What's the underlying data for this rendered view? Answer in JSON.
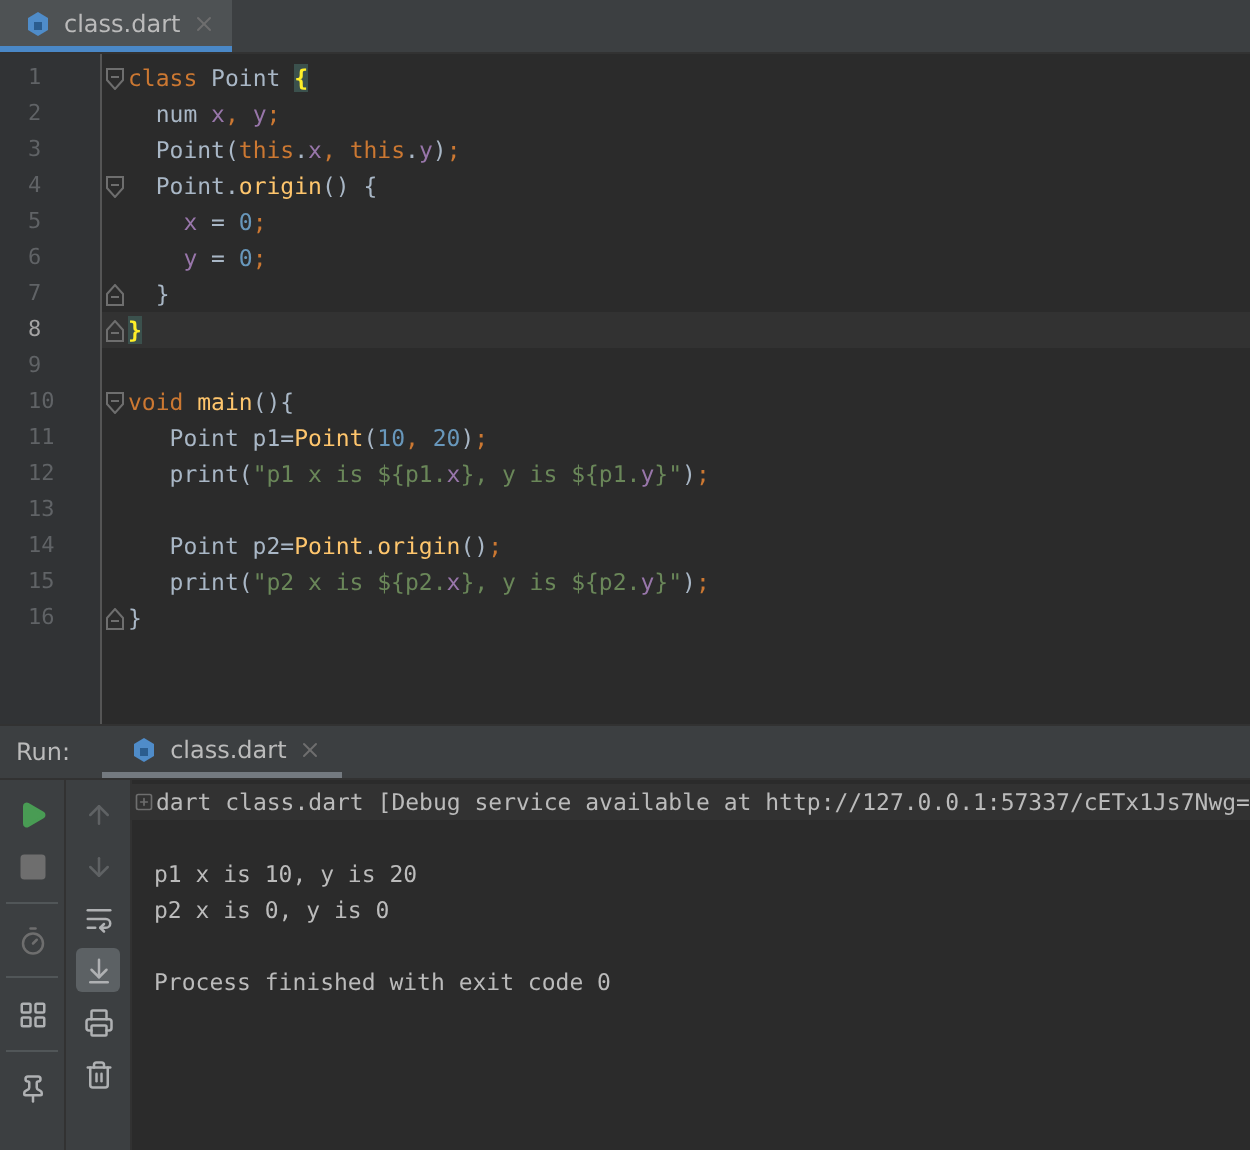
{
  "editor_tabs": [
    {
      "label": "class.dart",
      "selected": true
    }
  ],
  "editor": {
    "lines": [
      {
        "number": "1",
        "fold_start": true,
        "fold_end": false,
        "current": false,
        "tokens": [
          {
            "kind": "keyword",
            "text": "class"
          },
          {
            "kind": "plain",
            "text": " Point "
          },
          {
            "kind": "match",
            "text": "{"
          }
        ]
      },
      {
        "number": "2",
        "fold_start": false,
        "fold_end": false,
        "current": false,
        "tokens": [
          {
            "kind": "plain",
            "text": "  num "
          },
          {
            "kind": "field",
            "text": "x"
          },
          {
            "kind": "keyword",
            "text": ", "
          },
          {
            "kind": "field",
            "text": "y"
          },
          {
            "kind": "keyword",
            "text": ";"
          }
        ]
      },
      {
        "number": "3",
        "fold_start": false,
        "fold_end": false,
        "current": false,
        "tokens": [
          {
            "kind": "plain",
            "text": "  Point("
          },
          {
            "kind": "keyword",
            "text": "this"
          },
          {
            "kind": "plain",
            "text": "."
          },
          {
            "kind": "field",
            "text": "x"
          },
          {
            "kind": "keyword",
            "text": ", this"
          },
          {
            "kind": "plain",
            "text": "."
          },
          {
            "kind": "field",
            "text": "y"
          },
          {
            "kind": "plain",
            "text": ")"
          },
          {
            "kind": "keyword",
            "text": ";"
          }
        ]
      },
      {
        "number": "4",
        "fold_start": true,
        "fold_end": false,
        "current": false,
        "tokens": [
          {
            "kind": "plain",
            "text": "  Point."
          },
          {
            "kind": "function",
            "text": "origin"
          },
          {
            "kind": "plain",
            "text": "() {"
          }
        ]
      },
      {
        "number": "5",
        "fold_start": false,
        "fold_end": false,
        "current": false,
        "tokens": [
          {
            "kind": "field",
            "text": "    x"
          },
          {
            "kind": "plain",
            "text": " = "
          },
          {
            "kind": "number",
            "text": "0"
          },
          {
            "kind": "keyword",
            "text": ";"
          }
        ]
      },
      {
        "number": "6",
        "fold_start": false,
        "fold_end": false,
        "current": false,
        "tokens": [
          {
            "kind": "field",
            "text": "    y"
          },
          {
            "kind": "plain",
            "text": " = "
          },
          {
            "kind": "number",
            "text": "0"
          },
          {
            "kind": "keyword",
            "text": ";"
          }
        ]
      },
      {
        "number": "7",
        "fold_start": false,
        "fold_end": true,
        "current": false,
        "tokens": [
          {
            "kind": "plain",
            "text": "  }"
          }
        ]
      },
      {
        "number": "8",
        "fold_start": false,
        "fold_end": true,
        "current": true,
        "tokens": [
          {
            "kind": "match",
            "text": "}"
          }
        ]
      },
      {
        "number": "9",
        "fold_start": false,
        "fold_end": false,
        "current": false
      },
      {
        "number": "10",
        "fold_start": true,
        "fold_end": false,
        "current": false,
        "tokens": [
          {
            "kind": "keyword",
            "text": "void "
          },
          {
            "kind": "function",
            "text": "main"
          },
          {
            "kind": "plain",
            "text": "(){"
          }
        ]
      },
      {
        "number": "11",
        "fold_start": false,
        "fold_end": false,
        "current": false,
        "tokens": [
          {
            "kind": "plain",
            "text": "   Point p1="
          },
          {
            "kind": "function",
            "text": "Point"
          },
          {
            "kind": "plain",
            "text": "("
          },
          {
            "kind": "number",
            "text": "10"
          },
          {
            "kind": "keyword",
            "text": ", "
          },
          {
            "kind": "number",
            "text": "20"
          },
          {
            "kind": "plain",
            "text": ")"
          },
          {
            "kind": "keyword",
            "text": ";"
          }
        ]
      },
      {
        "number": "12",
        "fold_start": false,
        "fold_end": false,
        "current": false,
        "tokens": [
          {
            "kind": "plain",
            "text": "   print("
          },
          {
            "kind": "string",
            "text": "\"p1 x is ${p1."
          },
          {
            "kind": "field",
            "text": "x"
          },
          {
            "kind": "string",
            "text": "}, y is ${p1."
          },
          {
            "kind": "field",
            "text": "y"
          },
          {
            "kind": "string",
            "text": "}\""
          },
          {
            "kind": "plain",
            "text": ")"
          },
          {
            "kind": "keyword",
            "text": ";"
          }
        ]
      },
      {
        "number": "13",
        "fold_start": false,
        "fold_end": false,
        "current": false
      },
      {
        "number": "14",
        "fold_start": false,
        "fold_end": false,
        "current": false,
        "tokens": [
          {
            "kind": "plain",
            "text": "   Point p2="
          },
          {
            "kind": "function",
            "text": "Point"
          },
          {
            "kind": "plain",
            "text": "."
          },
          {
            "kind": "function",
            "text": "origin"
          },
          {
            "kind": "plain",
            "text": "()"
          },
          {
            "kind": "keyword",
            "text": ";"
          }
        ]
      },
      {
        "number": "15",
        "fold_start": false,
        "fold_end": false,
        "current": false,
        "tokens": [
          {
            "kind": "plain",
            "text": "   print("
          },
          {
            "kind": "string",
            "text": "\"p2 x is ${p2."
          },
          {
            "kind": "field",
            "text": "x"
          },
          {
            "kind": "string",
            "text": "}, y is ${p2."
          },
          {
            "kind": "field",
            "text": "y"
          },
          {
            "kind": "string",
            "text": "}\""
          },
          {
            "kind": "plain",
            "text": ")"
          },
          {
            "kind": "keyword",
            "text": ";"
          }
        ]
      },
      {
        "number": "16",
        "fold_start": false,
        "fold_end": true,
        "current": false,
        "tokens": [
          {
            "kind": "plain",
            "text": "}"
          }
        ]
      }
    ]
  },
  "run_panel": {
    "label": "Run:",
    "tabs": [
      {
        "label": "class.dart",
        "selected": true
      }
    ],
    "toolbar_left": [
      {
        "kind": "play"
      },
      {
        "kind": "stop"
      },
      {
        "kind": "divider"
      },
      {
        "kind": "timer"
      },
      {
        "kind": "divider"
      },
      {
        "kind": "layout"
      },
      {
        "kind": "divider"
      },
      {
        "kind": "pin"
      }
    ],
    "toolbar_right": [
      {
        "kind": "up",
        "selected": false
      },
      {
        "kind": "down",
        "selected": false
      },
      {
        "kind": "wrap",
        "selected": false
      },
      {
        "kind": "scroll-end",
        "selected": true
      },
      {
        "kind": "print",
        "selected": false
      },
      {
        "kind": "trash",
        "selected": false
      }
    ],
    "output": [
      {
        "kind": "command",
        "text": "dart class.dart [Debug service available at http://127.0.0.1:57337/cETx1Js7Nwg="
      },
      {
        "kind": "blank"
      },
      {
        "kind": "stdout",
        "text": "p1 x is 10, y is 20"
      },
      {
        "kind": "stdout",
        "text": "p2 x is 0, y is 0"
      },
      {
        "kind": "blank"
      },
      {
        "kind": "stdout",
        "text": "Process finished with exit code 0"
      }
    ]
  }
}
